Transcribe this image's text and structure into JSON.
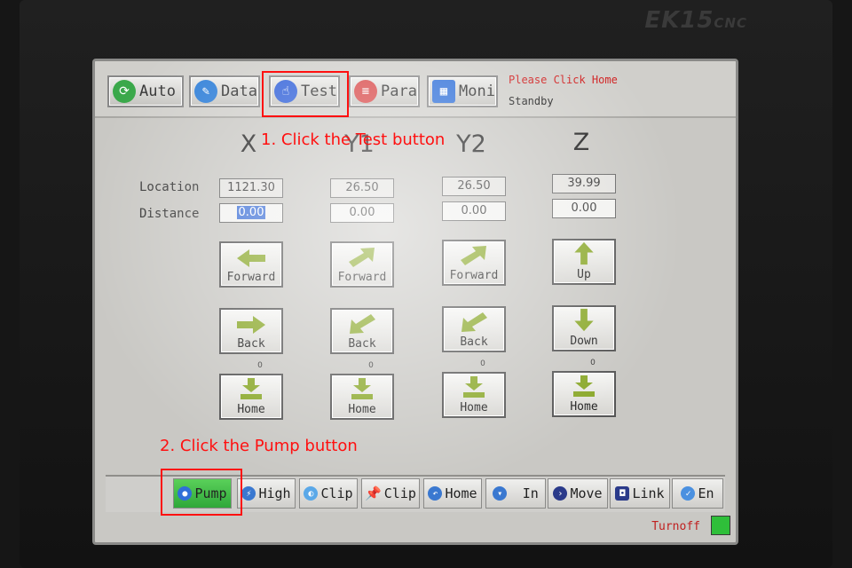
{
  "brand": {
    "name": "EK15",
    "suffix": "CNC"
  },
  "tabs": [
    {
      "label": "Auto",
      "icon": "cycle-icon",
      "color": "#3aa84a"
    },
    {
      "label": "Data",
      "icon": "pencil-icon",
      "color": "#2f7fd8"
    },
    {
      "label": "Test",
      "icon": "touch-hand-icon",
      "color": "#3060d8"
    },
    {
      "label": "Para",
      "icon": "sliders-icon",
      "color": "#d84848"
    },
    {
      "label": "Moni",
      "icon": "monitor-chart-icon",
      "color": "#2f6fd8"
    }
  ],
  "status": {
    "message": "Please Click Home",
    "state": "Standby"
  },
  "axes": [
    {
      "name": "X",
      "location": "1121.30",
      "distance": "0.00",
      "forward": "Forward",
      "back": "Back",
      "home": "Home",
      "count": "0"
    },
    {
      "name": "Y1",
      "location": "26.50",
      "distance": "0.00",
      "forward": "Forward",
      "back": "Back",
      "home": "Home",
      "count": "0"
    },
    {
      "name": "Y2",
      "location": "26.50",
      "distance": "0.00",
      "forward": "Forward",
      "back": "Back",
      "home": "Home",
      "count": "0"
    },
    {
      "name": "Z",
      "location": "39.99",
      "distance": "0.00",
      "forward": "Up",
      "back": "Down",
      "home": "Home",
      "count": "0"
    }
  ],
  "labels": {
    "location": "Location",
    "distance": "Distance"
  },
  "bottom_buttons": [
    {
      "label": "Pump",
      "icon": "pump-icon"
    },
    {
      "label": "High",
      "icon": "lightning-icon"
    },
    {
      "label": "Clip",
      "icon": "clip-open-icon"
    },
    {
      "label": "Clip",
      "icon": "pin-icon"
    },
    {
      "label": "Home",
      "icon": "return-icon"
    },
    {
      "label": "In",
      "icon": "shield-icon"
    },
    {
      "label": "Move",
      "icon": "arrow-right-icon"
    },
    {
      "label": "Link",
      "icon": "link-icon"
    },
    {
      "label": "En",
      "icon": "check-icon"
    }
  ],
  "footer": {
    "turnoff": "Turnoff",
    "led_color": "#2fbf3a"
  },
  "annotations": {
    "step1": "1. Click the Test button",
    "step2": "2. Click the Pump button"
  }
}
